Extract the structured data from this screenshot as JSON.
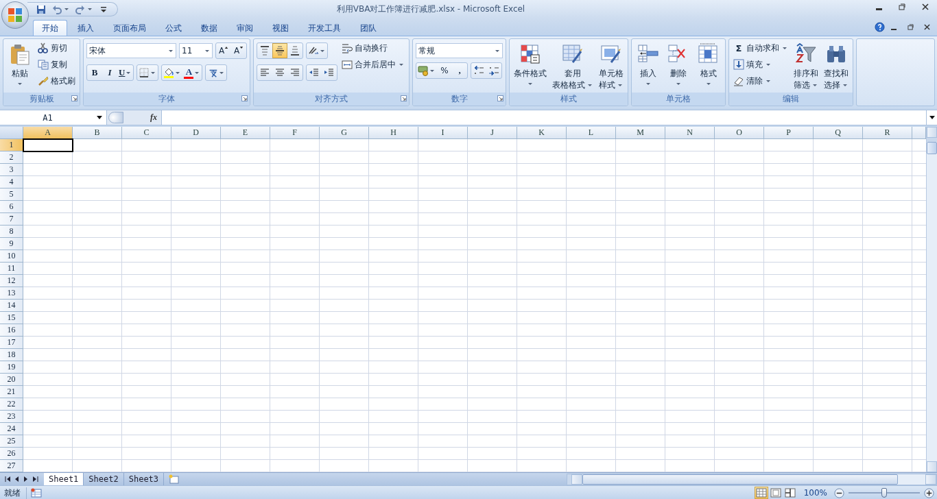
{
  "window": {
    "title": "利用VBA对工作簿进行减肥.xlsx - Microsoft Excel"
  },
  "quick_access": [
    {
      "kind": "save"
    },
    {
      "kind": "undo"
    },
    {
      "kind": "redo"
    },
    {
      "kind": "customize"
    }
  ],
  "tabs": [
    {
      "label": "开始",
      "selected": true
    },
    {
      "label": "插入",
      "selected": false
    },
    {
      "label": "页面布局",
      "selected": false
    },
    {
      "label": "公式",
      "selected": false
    },
    {
      "label": "数据",
      "selected": false
    },
    {
      "label": "审阅",
      "selected": false
    },
    {
      "label": "视图",
      "selected": false
    },
    {
      "label": "开发工具",
      "selected": false
    },
    {
      "label": "团队",
      "selected": false
    }
  ],
  "ribbon": [
    {
      "label": "剪贴板",
      "launcher": true,
      "columns": [
        [
          {
            "kind": "clipboard",
            "lines": [
              "粘贴"
            ]
          }
        ],
        [
          {
            "kind": "scissors",
            "label": "剪切"
          },
          {
            "kind": "pages",
            "label": "复制"
          },
          {
            "kind": "brush",
            "label": "格式刷"
          }
        ]
      ]
    },
    {
      "label": "字体",
      "launcher": true,
      "columns": [
        [
          {
            "kind": "row",
            "items": [
              {
                "kind": "font-name",
                "value": "宋体"
              },
              {
                "kind": "font-size",
                "value": "11"
              },
              {
                "kind": "toolbar",
                "buttons": [
                  {
                    "kind": "grow-font",
                    "text": "A"
                  },
                  {
                    "kind": "shrink-font",
                    "text": "A"
                  }
                ]
              }
            ]
          },
          {
            "kind": "row",
            "items": [
              {
                "kind": "toolbar",
                "buttons": [
                  {
                    "kind": "bold",
                    "text": "B"
                  },
                  {
                    "kind": "italic",
                    "text": "I"
                  },
                  {
                    "kind": "underline",
                    "text": "U"
                  }
                ]
              },
              {
                "kind": "toolbar",
                "buttons": [
                  {
                    "kind": "borders"
                  }
                ]
              },
              {
                "kind": "toolbar",
                "buttons": [
                  {
                    "kind": "paint-bucket"
                  },
                  {
                    "kind": "font-color",
                    "text": "A"
                  }
                ]
              },
              {
                "kind": "toolbar",
                "buttons": [
                  {
                    "kind": "phonetic"
                  }
                ]
              }
            ]
          }
        ]
      ]
    },
    {
      "label": "对齐方式",
      "launcher": true,
      "columns": [
        [
          {
            "kind": "row",
            "items": [
              {
                "kind": "toolbar",
                "buttons": [
                  {
                    "kind": "align-top",
                    "selected": false
                  },
                  {
                    "kind": "align-middle",
                    "selected": true
                  },
                  {
                    "kind": "align-bottom",
                    "selected": false
                  }
                ]
              },
              {
                "kind": "toolbar",
                "buttons": [
                  {
                    "kind": "text-angle"
                  }
                ]
              }
            ]
          },
          {
            "kind": "row",
            "items": [
              {
                "kind": "toolbar",
                "buttons": [
                  {
                    "kind": "align-left"
                  },
                  {
                    "kind": "align-center"
                  },
                  {
                    "kind": "align-right"
                  }
                ]
              },
              {
                "kind": "toolbar",
                "buttons": [
                  {
                    "kind": "outdent"
                  },
                  {
                    "kind": "indent"
                  }
                ]
              }
            ]
          }
        ],
        [
          {
            "kind": "wrap-text",
            "label": "自动换行"
          },
          {
            "kind": "merge-cells",
            "label": "合并后居中"
          }
        ]
      ]
    },
    {
      "label": "数字",
      "launcher": true,
      "columns": [
        [
          {
            "kind": "number-format",
            "value": "常规"
          },
          {
            "kind": "row",
            "items": [
              {
                "kind": "toolbar",
                "buttons": [
                  {
                    "kind": "money"
                  },
                  {
                    "kind": "percent",
                    "text": "%"
                  },
                  {
                    "kind": "comma",
                    "text": ","
                  }
                ]
              },
              {
                "kind": "toolbar",
                "buttons": [
                  {
                    "kind": "decimal-increase"
                  },
                  {
                    "kind": "decimal-decrease"
                  }
                ]
              }
            ]
          }
        ]
      ]
    },
    {
      "label": "样式",
      "launcher": false,
      "columns": [
        [
          {
            "kind": "highlighted-grid",
            "lines": [
              "条件格式"
            ]
          }
        ],
        [
          {
            "kind": "table-brush",
            "lines": [
              "套用",
              "表格格式"
            ]
          }
        ],
        [
          {
            "kind": "cell-brush",
            "lines": [
              "单元格",
              "样式"
            ]
          }
        ]
      ]
    },
    {
      "label": "单元格",
      "launcher": false,
      "columns": [
        [
          {
            "kind": "insert-cells",
            "lines": [
              "插入"
            ]
          }
        ],
        [
          {
            "kind": "delete-cells",
            "lines": [
              "删除"
            ]
          }
        ],
        [
          {
            "kind": "cell-format",
            "lines": [
              "格式"
            ]
          }
        ]
      ]
    },
    {
      "label": "编辑",
      "launcher": false,
      "columns": [
        [
          {
            "kind": "sum",
            "glyph": "Σ",
            "label": "自动求和"
          },
          {
            "kind": "fill-down-arrow",
            "label": "填充"
          },
          {
            "kind": "eraser",
            "label": "清除"
          }
        ],
        [
          {
            "kind": "sort-filter",
            "lines": [
              "排序和",
              "筛选"
            ]
          }
        ],
        [
          {
            "kind": "binoculars",
            "lines": [
              "查找和",
              "选择"
            ]
          }
        ]
      ]
    }
  ],
  "formula_bar": {
    "name_box": "A1",
    "function_label": "fx"
  },
  "columns": [
    {
      "label": "A",
      "selected": true
    },
    {
      "label": "B",
      "selected": false
    },
    {
      "label": "C",
      "selected": false
    },
    {
      "label": "D",
      "selected": false
    },
    {
      "label": "E",
      "selected": false
    },
    {
      "label": "F",
      "selected": false
    },
    {
      "label": "G",
      "selected": false
    },
    {
      "label": "H",
      "selected": false
    },
    {
      "label": "I",
      "selected": false
    },
    {
      "label": "J",
      "selected": false
    },
    {
      "label": "K",
      "selected": false
    },
    {
      "label": "L",
      "selected": false
    },
    {
      "label": "M",
      "selected": false
    },
    {
      "label": "N",
      "selected": false
    },
    {
      "label": "O",
      "selected": false
    },
    {
      "label": "P",
      "selected": false
    },
    {
      "label": "Q",
      "selected": false
    },
    {
      "label": "R",
      "selected": false
    }
  ],
  "rows": [
    {
      "label": "1",
      "selected": true
    },
    {
      "label": "2",
      "selected": false
    },
    {
      "label": "3",
      "selected": false
    },
    {
      "label": "4",
      "selected": false
    },
    {
      "label": "5",
      "selected": false
    },
    {
      "label": "6",
      "selected": false
    },
    {
      "label": "7",
      "selected": false
    },
    {
      "label": "8",
      "selected": false
    },
    {
      "label": "9",
      "selected": false
    },
    {
      "label": "10",
      "selected": false
    },
    {
      "label": "11",
      "selected": false
    },
    {
      "label": "12",
      "selected": false
    },
    {
      "label": "13",
      "selected": false
    },
    {
      "label": "14",
      "selected": false
    },
    {
      "label": "15",
      "selected": false
    },
    {
      "label": "16",
      "selected": false
    },
    {
      "label": "17",
      "selected": false
    },
    {
      "label": "18",
      "selected": false
    },
    {
      "label": "19",
      "selected": false
    },
    {
      "label": "20",
      "selected": false
    },
    {
      "label": "21",
      "selected": false
    },
    {
      "label": "22",
      "selected": false
    },
    {
      "label": "23",
      "selected": false
    },
    {
      "label": "24",
      "selected": false
    },
    {
      "label": "25",
      "selected": false
    },
    {
      "label": "26",
      "selected": false
    },
    {
      "label": "27",
      "selected": false
    }
  ],
  "sheet_tabs": [
    {
      "label": "Sheet1",
      "selected": true
    },
    {
      "label": "Sheet2",
      "selected": false
    },
    {
      "label": "Sheet3",
      "selected": false
    }
  ],
  "status_bar": {
    "mode": "就绪",
    "views": [
      {
        "kind": "normal-view",
        "selected": true
      },
      {
        "kind": "page-layout-view",
        "selected": false
      },
      {
        "kind": "page-break-view",
        "selected": false
      }
    ],
    "zoom": "100%",
    "zoom_slider": {
      "level": 0.5
    }
  }
}
